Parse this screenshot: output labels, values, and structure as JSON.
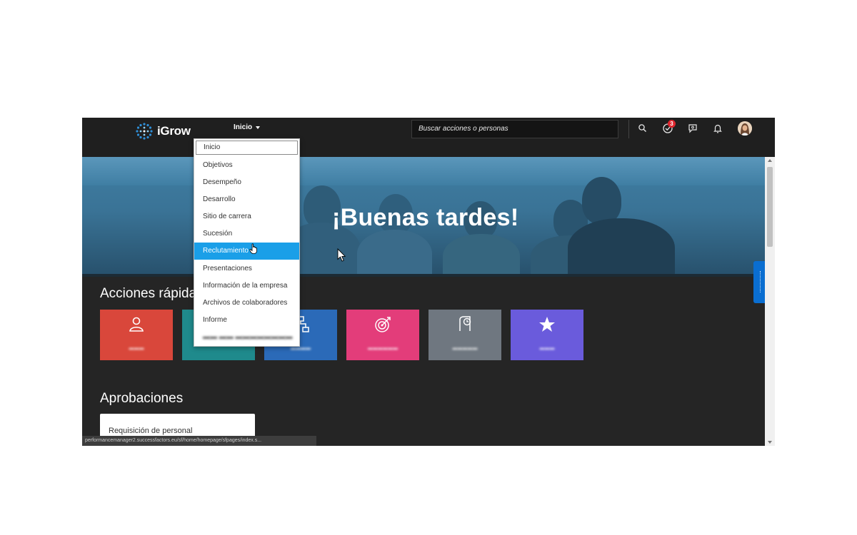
{
  "header": {
    "logo_text": "iGrow",
    "nav_label": "Inicio",
    "search_placeholder": "Buscar acciones o personas",
    "notification_count": "3"
  },
  "nav_menu": {
    "items": [
      {
        "label": "Inicio"
      },
      {
        "label": "Objetivos"
      },
      {
        "label": "Desempeño"
      },
      {
        "label": "Desarrollo"
      },
      {
        "label": "Sitio de carrera"
      },
      {
        "label": "Sucesión"
      },
      {
        "label": "Reclutamiento"
      },
      {
        "label": "Presentaciones"
      },
      {
        "label": "Información de la empresa"
      },
      {
        "label": "Archivos de colaboradores"
      },
      {
        "label": "Informe"
      }
    ],
    "selected_label": "Inicio",
    "hovered_label": "Reclutamiento"
  },
  "hero": {
    "greeting": "¡Buenas tardes!"
  },
  "quick_actions": {
    "title": "Acciones rápidas",
    "tiles": [
      {
        "icon": "person-icon",
        "color": "#d9473b"
      },
      {
        "icon": "hidden-icon",
        "color": "#1f8a8c"
      },
      {
        "icon": "org-chart-icon",
        "color": "#2b6ab8"
      },
      {
        "icon": "target-icon",
        "color": "#e33d7a"
      },
      {
        "icon": "document-clock-icon",
        "color": "#6f7780"
      },
      {
        "icon": "star-icon",
        "color": "#6a5bdc"
      }
    ]
  },
  "approvals": {
    "title": "Aprobaciones",
    "card_label": "Requisición de personal"
  },
  "status_bar": {
    "url": "performancemanager2.successfactors.eu/sf/home/homepage/sfpages/index.s..."
  },
  "colors": {
    "accent": "#1a9fe8",
    "topbar": "#1f1f1f",
    "page_background": "#252525",
    "side_tab": "#0a6ed1"
  }
}
